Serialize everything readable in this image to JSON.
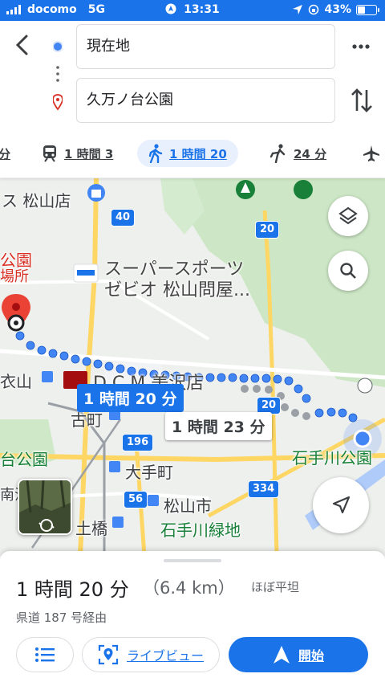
{
  "status_bar": {
    "carrier": "docomo",
    "network": "5G",
    "time": "13:31",
    "battery_percent": "43%",
    "battery_level": 0.43
  },
  "header": {
    "origin": "現在地",
    "destination": "久万ノ台公園"
  },
  "modes": [
    {
      "name": "driving",
      "label": "分"
    },
    {
      "name": "transit",
      "label": "1 時間 3"
    },
    {
      "name": "walking",
      "label": "1 時間 20"
    },
    {
      "name": "ride",
      "label": "24 分"
    },
    {
      "name": "flight",
      "label": ""
    }
  ],
  "map": {
    "labels": {
      "matsuyama_store": "ス 松山店",
      "park_top": "公園",
      "office": "場所",
      "super_sports_1": "スーパースポーツ",
      "super_sports_2": "ゼビオ 松山問屋...",
      "koromoyama": "衣山",
      "dcm": "D C M 美沢店",
      "furumachi": "古町",
      "ote_park": "台公園",
      "ishite_park": "石手川公園",
      "otemachi": "大手町",
      "matsuyama_city": "松山市",
      "dobashi": "土橋",
      "ishite_green": "石手川緑地",
      "minami": "南江"
    },
    "shields": {
      "r40": "40",
      "r20a": "20",
      "r20b": "20",
      "r196": "196",
      "r56": "56",
      "r334": "334"
    },
    "route_main_time": "1 時間 20 分",
    "route_alt_time": "1 時間 23 分"
  },
  "sheet": {
    "duration": "1 時間 20 分",
    "distance": "（6.4 km）",
    "terrain": "ほぼ平坦",
    "via": "県道 187 号経由",
    "live_view_label": "ライブビュー",
    "start_label": "開始"
  },
  "colors": {
    "accent": "#1a73e8",
    "route_dot": "#4285f4",
    "alt_route_dot": "#9aa0a6",
    "pin_red": "#d93025"
  }
}
